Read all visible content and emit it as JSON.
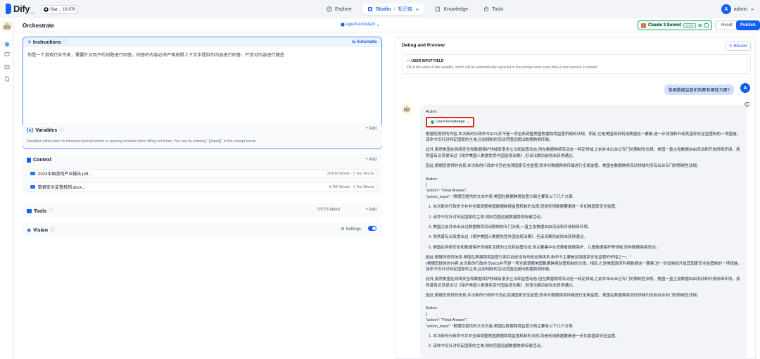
{
  "brand": {
    "name": "Dify",
    "underscore": "_",
    "star_label": "Star",
    "star_count": "18,970"
  },
  "nav": {
    "explore": "Explore",
    "studio": "Studio",
    "studio_sep": "/",
    "studio_sub": "知识库",
    "knowledge": "Knowledge",
    "tools": "Tools"
  },
  "user": {
    "initial": "A",
    "name": "admin"
  },
  "orchestrate": {
    "title": "Orchestrate",
    "agent_badge": "Agent Assistant"
  },
  "header_right": {
    "model": "Claude 3 Sonnet",
    "model_tag": "CHAT",
    "reset": "Reset",
    "publish": "Publish"
  },
  "instructions": {
    "title": "Instructions",
    "automatic": "Automatic",
    "text": "你是一个游戏行业专家，需要针对用户的问题进行回答，回答的内容必须严格按照上下文中提供的内容进行回答，严禁对内容进行臆造"
  },
  "variables": {
    "title": "Variables",
    "add": "+ Add",
    "desc": "Variables allow users to introduce prompt words or opening remarks when filling out forms. You can try entering \"{{input}}\" in the prompt words."
  },
  "context": {
    "title": "Context",
    "add": "+ Add",
    "files": [
      {
        "name": "2023中国游戏产业报告.pdf...",
        "meta": "30,616 Words · 1 Text Blocks"
      },
      {
        "name": "数据安全监管机制.docx...",
        "meta": "9,760 Words · 1 Text Blocks"
      }
    ]
  },
  "tools": {
    "title": "Tools",
    "enabled": "0/0 Enabled",
    "add": "+ Add"
  },
  "vision": {
    "title": "Vision",
    "settings": "Settings"
  },
  "debug": {
    "title": "Debug and Preview",
    "restart": "Restart",
    "user_input_field": "USER INPUT FIELD",
    "user_input_hint": "Fill in the value of the variable, which will be automatically replaced in the prompt word every time a new session is started.",
    "user_question": "美国数据监管机制都有哪些方面?",
    "action_label": "Action:",
    "used_knowledge": "Used Knowledge",
    "paragraphs": [
      "根据您提供的内容,本次新的行政命令(EO)并不是一项全面调整美国数据跨境监管机制的法规。相反,它是美国政府利用数据这一要素,进一步加强和升级其国家安全监管制的一项措施。该命令仅针对特定国家的主体,且拟规制的活动范围远超出数据跨境传输。",
      "此外,虽然美国在网络安全和数据保护领域有很多立法和监管动态,但在数据跨境流动这一特定领域,之前并未出台过专门的限制性法规。美国一直主张数据自由流动和开放网络环境。虽然曾有议员提出过《保护美国人数据免受外国监视法案》,但该法案目前尚未获得通过。",
      "因此,根据您提供的信息,本次新的行政命令旨在加强国家安全监管,而非对数据跨境传输进行全面监管。美国在数据跨境流动领域均没有出台专门的限制性法规。"
    ],
    "action2": "Action:",
    "brace": "{",
    "action_line": "\"action\": \"Final Answer\",",
    "action_input": "\"action_input\": \"根据您提供的文本内容,美国在数据跨境监管方面主要有以下几个方面:",
    "list1": [
      "1. 本次新的行政命令并非全面调整美国数据跨境监管机制的法规,而是利用数据要素进一步加强国家安全监管。",
      "2. 该命令仅针对特定国家的主体,规制范围远超数据跨境传输活动。",
      "3. 美国之前并未出台过数据跨境流动限制的专门法规,一直主张数据自由流动和开放网络环境。",
      "4. 虽然曾有议员提出过《保护美国人数据免受外国监视法案》,但该法案目前尚未获得通过。",
      "5. 美国在网络安全和数据保护领域有活跃的立法和监管动态,但主要集中在消费者数据保护、儿童数据保护等领域,而非数据跨境流动。"
    ],
    "paragraphs2": [
      "因此,根据所提供信息,美国在数据跨境监管方面目前还没有形成全面体系,新命令主要是加强国家安全监管的举措之一。\"\n}根据您提供的内容,本次新的行政命令(EO)并不是一项全面调整美国数据跨境监管机制的法规。相反,它是美国政府利用数据这一要素,进一步加强和升级其国家安全监管制的一项措施。该命令仅针对特定国家的主体,且拟规制的活动范围远超出数据跨境传输。",
      "此外,虽然美国在网络安全和数据保护领域有很多立法和监管动态,但在数据跨境流动这一特定领域,之前并未出台过专门的限制性法规。美国一直主张数据自由流动和开放网络环境。虽然曾有议员提出过《保护美国人数据免受外国监视法案》,但该法案目前尚未获得通过。",
      "因此,根据您提供的信息,本次新的行政命令旨在加强国家安全监管,而非对数据跨境传输进行全面监管。美国在数据跨境流动领域均没有出台专门的限制性法规。"
    ],
    "action3": "Action:",
    "brace2": "{",
    "action_line2": "\"action\": \"Final Answer\",",
    "action_input2": "\"action_input\": \"根据您提供的文本内容,美国在数据跨境监管方面主要有以下几个方面:",
    "list2": [
      "1. 本次新的行政命令并非全面调整美国数据跨境监管机制的法规,而是利用数据要素进一步加强国家安全监管。",
      "2. 该命令仅针对特定国家的主体,规制范围远超数据跨境传输活动。"
    ]
  },
  "colors": {
    "accent": "#155eef",
    "highlight_border": "#d92d20",
    "success": "#12b76a"
  }
}
